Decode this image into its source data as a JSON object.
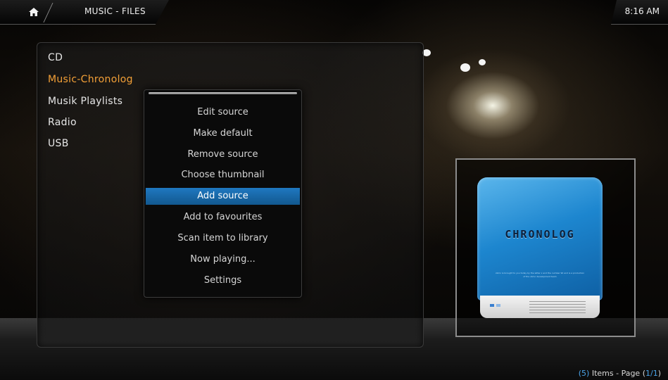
{
  "header": {
    "breadcrumb": "MUSIC - FILES",
    "clock": "8:16 AM"
  },
  "sources": [
    {
      "label": "CD",
      "focused": false
    },
    {
      "label": "Music-Chronolog",
      "focused": true
    },
    {
      "label": "Musik Playlists",
      "focused": false
    },
    {
      "label": "Radio",
      "focused": false
    },
    {
      "label": "USB",
      "focused": false
    }
  ],
  "context_menu": {
    "items": [
      "Edit source",
      "Make default",
      "Remove source",
      "Choose thumbnail",
      "Add source",
      "Add to favourites",
      "Scan item to library",
      "Now playing...",
      "Settings"
    ],
    "selected": "Add source"
  },
  "thumbnail": {
    "brand": "CHRONOLOG",
    "fine_print": "xbmc is brought to you today by the letter x and the number 90 and is a production of the xbmc development team"
  },
  "footer": {
    "count_open": "(",
    "count": "5",
    "count_close": ")",
    "items_text": " Items - Page ",
    "page_open": "(",
    "page": "1/1",
    "page_close": ")"
  },
  "colors": {
    "focus_text": "#f3a037",
    "selection_bg": "#1f78c0",
    "footer_highlight": "#4aa3e8"
  },
  "icons": {
    "home": "home-icon"
  }
}
